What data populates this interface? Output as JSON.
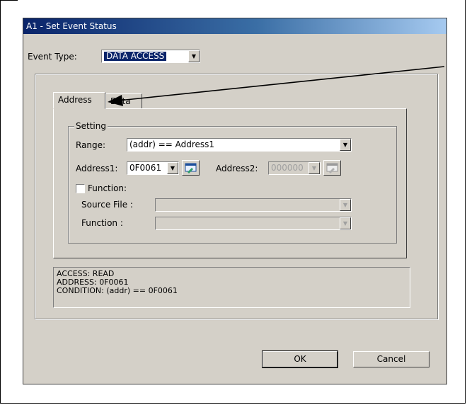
{
  "dialog": {
    "title": "A1 - Set Event Status",
    "event_type_label": "Event Type:",
    "event_type_value": "DATA ACCESS",
    "tabs": [
      {
        "label": "Address",
        "active": true
      },
      {
        "label": "Data",
        "active": false
      }
    ],
    "setting": {
      "group_label": "Setting",
      "range_label": "Range:",
      "range_value": "(addr) == Address1",
      "address1_label": "Address1:",
      "address1_value": "0F0061",
      "address2_label": "Address2:",
      "address2_value": "000000",
      "function_checkbox_label": "Function:",
      "function_checked": false,
      "source_file_label": "Source File :",
      "source_file_value": "",
      "function_label": "Function :",
      "function_value": ""
    },
    "info_lines": [
      "ACCESS: READ",
      "ADDRESS: 0F0061",
      "CONDITION: (addr) == 0F0061"
    ],
    "ok_label": "OK",
    "cancel_label": "Cancel"
  },
  "icons": {
    "dropdown": "chevron-down-icon",
    "address_browse": "browse-address-icon"
  }
}
